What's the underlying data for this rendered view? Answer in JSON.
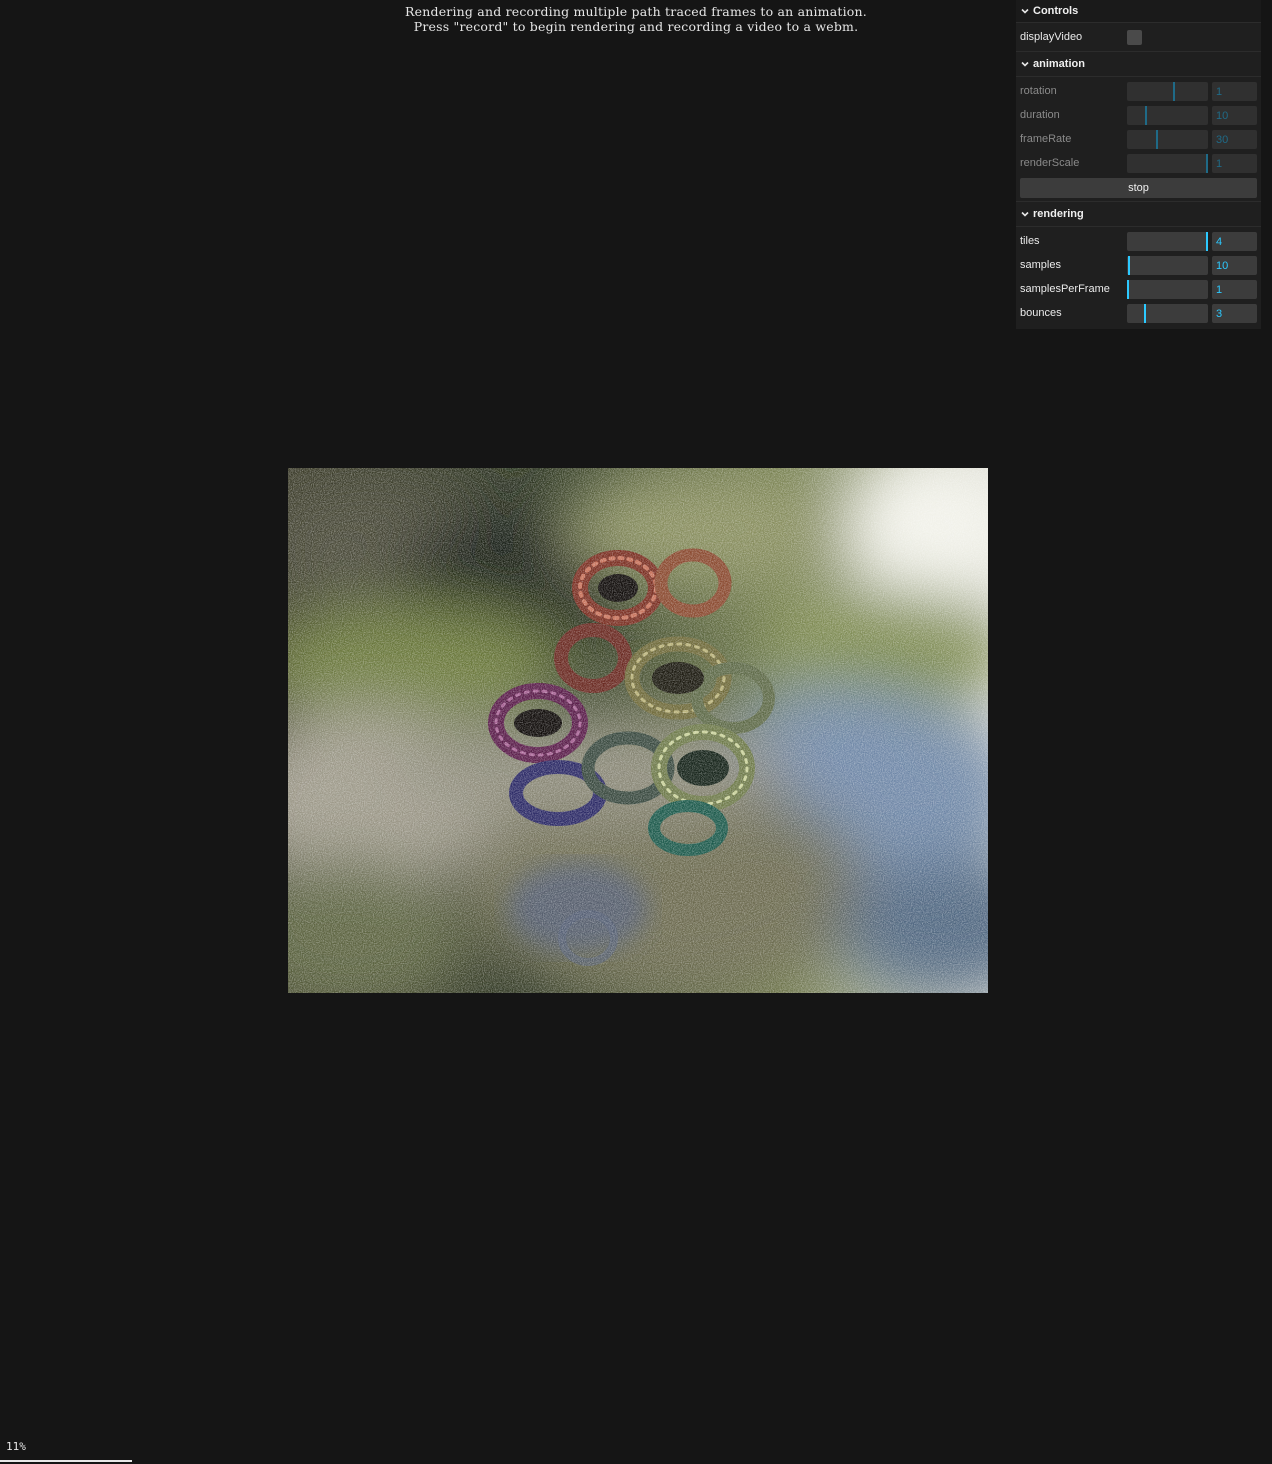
{
  "info": {
    "line1": "Rendering and recording multiple path traced frames to an animation.",
    "line2": "Press \"record\" to begin rendering and recording a video to a webm."
  },
  "gui": {
    "title": "Controls",
    "displayVideo": {
      "label": "displayVideo",
      "checked": false
    },
    "animation": {
      "title": "animation",
      "rotation": {
        "label": "rotation",
        "value": "1",
        "fraction": 0.58
      },
      "duration": {
        "label": "duration",
        "value": "10",
        "fraction": 0.23
      },
      "frameRate": {
        "label": "frameRate",
        "value": "30",
        "fraction": 0.37
      },
      "renderScale": {
        "label": "renderScale",
        "value": "1",
        "fraction": 0.99
      },
      "stop_label": "stop"
    },
    "rendering": {
      "title": "rendering",
      "tiles": {
        "label": "tiles",
        "value": "4",
        "fraction": 0.99
      },
      "samples": {
        "label": "samples",
        "value": "10",
        "fraction": 0.02
      },
      "samplesPerFrame": {
        "label": "samplesPerFrame",
        "value": "1",
        "fraction": 0.01
      },
      "bounces": {
        "label": "bounces",
        "value": "3",
        "fraction": 0.22
      }
    }
  },
  "progress": {
    "text": "11%",
    "fraction": 0.11
  },
  "colors": {
    "accent": "#2cc9ff",
    "background": "#151515",
    "panel": "#1f1f1f"
  }
}
